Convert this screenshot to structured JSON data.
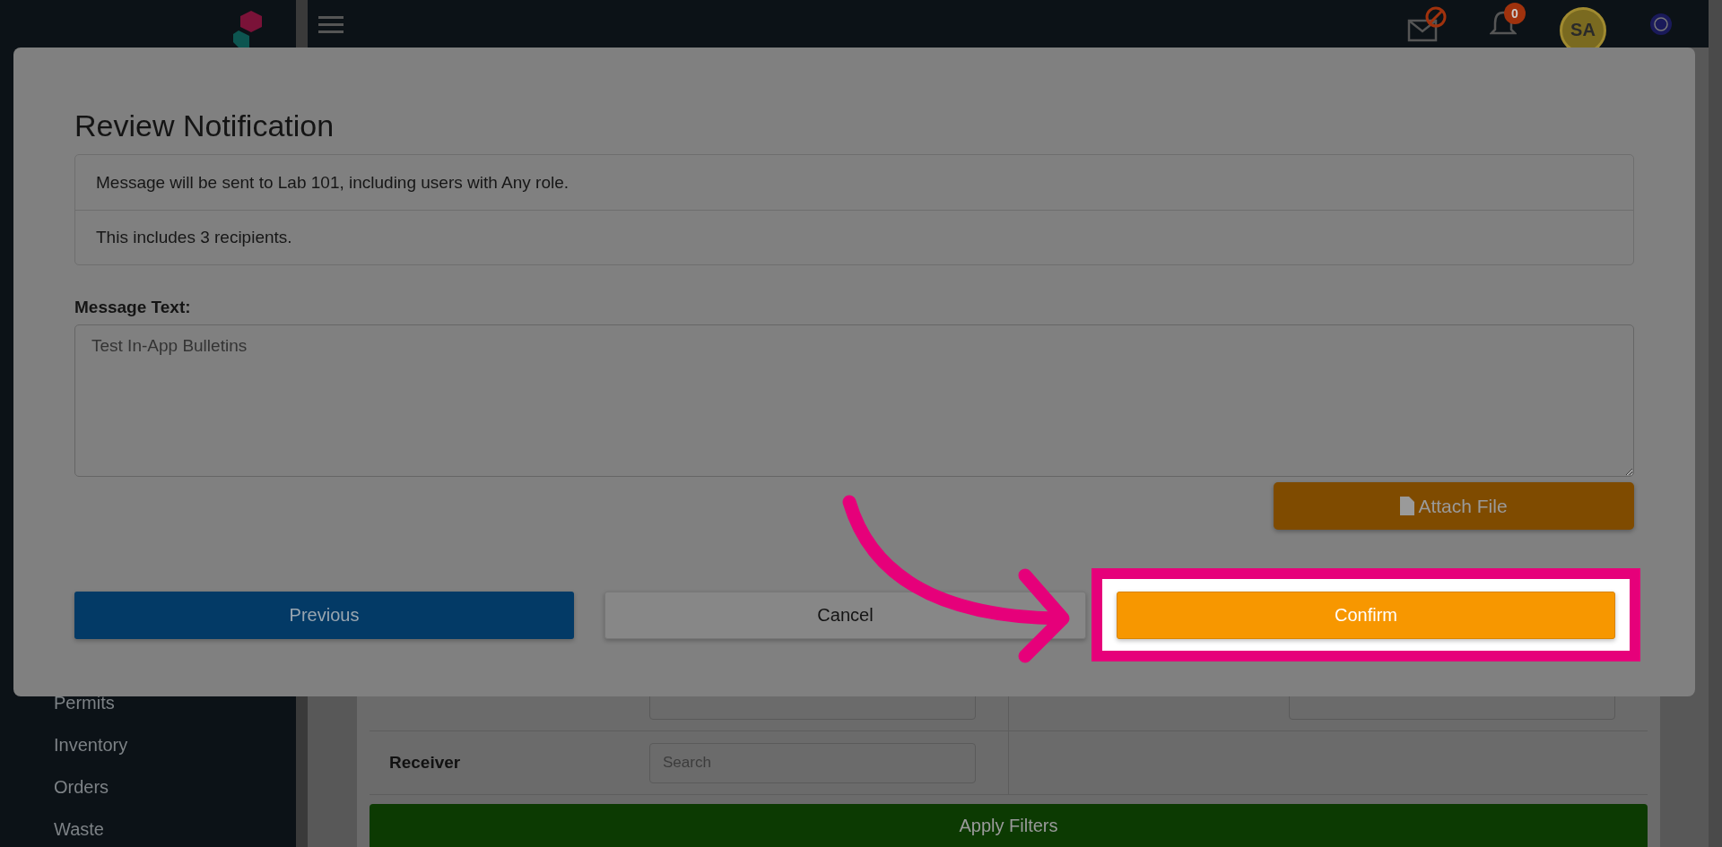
{
  "header": {
    "notification_count": "0",
    "avatar_initials": "SA"
  },
  "sidebar": {
    "items": [
      {
        "label": "Permits"
      },
      {
        "label": "Inventory"
      },
      {
        "label": "Orders"
      },
      {
        "label": "Waste"
      }
    ]
  },
  "filters": {
    "rows": [
      {
        "label": "Receiver",
        "placeholder": "Search"
      }
    ],
    "apply_button": "Apply Filters"
  },
  "modal": {
    "title": "Review Notification",
    "info_rows": [
      "Message will be sent to Lab 101, including users with Any role.",
      "This includes 3 recipients."
    ],
    "message_label": "Message Text:",
    "message_value": "Test In-App Bulletins",
    "attach_button": "Attach File",
    "buttons": [
      {
        "label": "Previous",
        "kind": "previous"
      },
      {
        "label": "Cancel",
        "kind": "cancel"
      },
      {
        "label": "Confirm",
        "kind": "confirm",
        "highlighted": true
      }
    ]
  }
}
